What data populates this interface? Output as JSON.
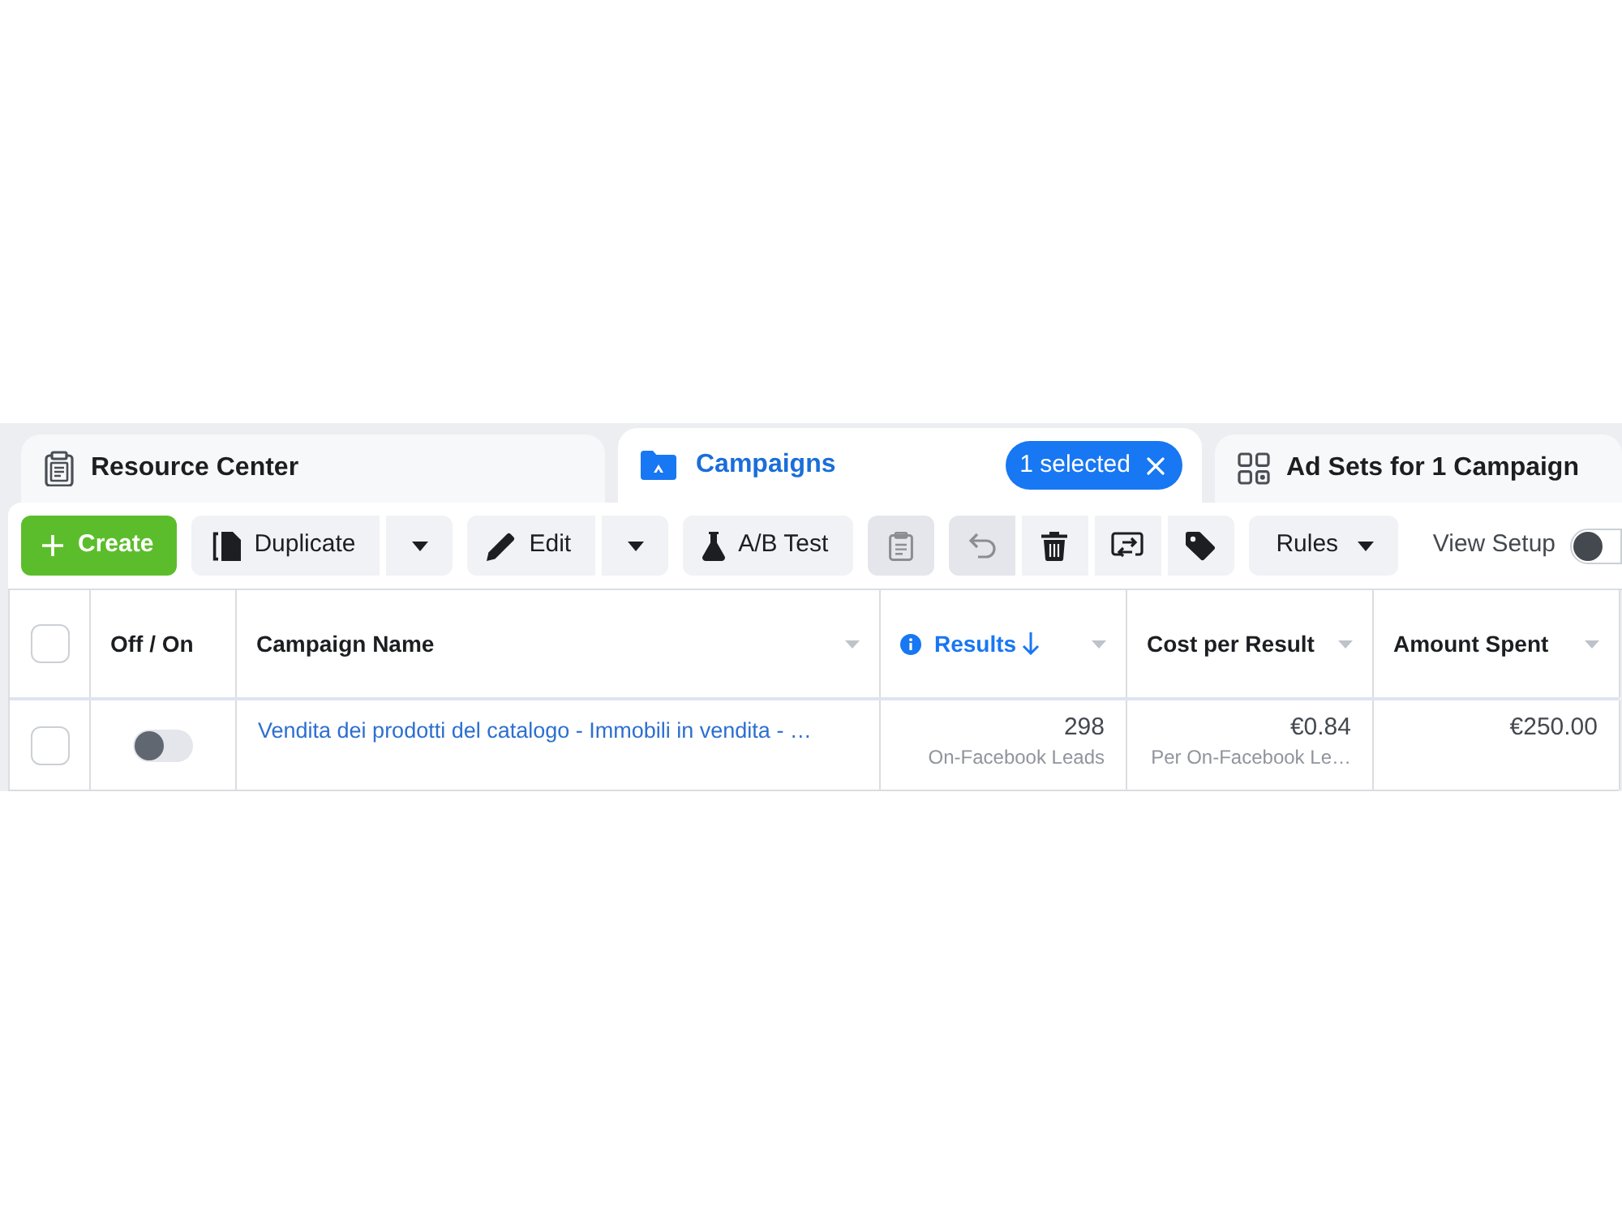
{
  "tabs": [
    {
      "label": "Resource Center",
      "selected": false
    },
    {
      "label": "Campaigns",
      "selected": true,
      "badge": "1 selected"
    },
    {
      "label": "Ad Sets for 1 Campaign",
      "selected": false
    }
  ],
  "toolbar": {
    "groups": [
      [
        {
          "kind": "create",
          "label": "Create"
        }
      ],
      [
        {
          "kind": "labeled",
          "label": "Duplicate"
        },
        {
          "kind": "dropdown"
        }
      ],
      [
        {
          "kind": "labeled",
          "label": "Edit"
        },
        {
          "kind": "dropdown"
        }
      ],
      [
        {
          "kind": "labeled",
          "label": "A/B Test"
        }
      ],
      [
        {
          "kind": "icon",
          "disabled": true
        }
      ],
      [
        {
          "kind": "icon",
          "disabled": true
        },
        {
          "kind": "icon",
          "disabled": false
        },
        {
          "kind": "icon",
          "disabled": false
        },
        {
          "kind": "icon",
          "disabled": false
        }
      ],
      [
        {
          "kind": "menu",
          "label": "Rules"
        }
      ]
    ],
    "view_setup": {
      "label": "View Setup",
      "on": false
    }
  },
  "table": {
    "select_all": {
      "checked": false
    },
    "columns": [
      {
        "label": "Off / On",
        "menu": false,
        "sorted": false,
        "info": false
      },
      {
        "label": "Campaign Name",
        "menu": true,
        "sorted": false,
        "info": false
      },
      {
        "label": "Results",
        "menu": true,
        "sorted": true,
        "info": true
      },
      {
        "label": "Cost per Result",
        "menu": true,
        "sorted": false,
        "info": false
      },
      {
        "label": "Amount Spent",
        "menu": true,
        "sorted": false,
        "info": false
      }
    ],
    "rows": [
      {
        "checked": false,
        "on": false,
        "campaign_name": "Vendita dei prodotti del catalogo - Immobili in vendita - …",
        "results": {
          "value": "298",
          "label": "On-Facebook Leads"
        },
        "cost_per_result": {
          "value": "€0.84",
          "label": "Per On-Facebook Le…"
        },
        "amount_spent": "€250.00"
      }
    ]
  }
}
